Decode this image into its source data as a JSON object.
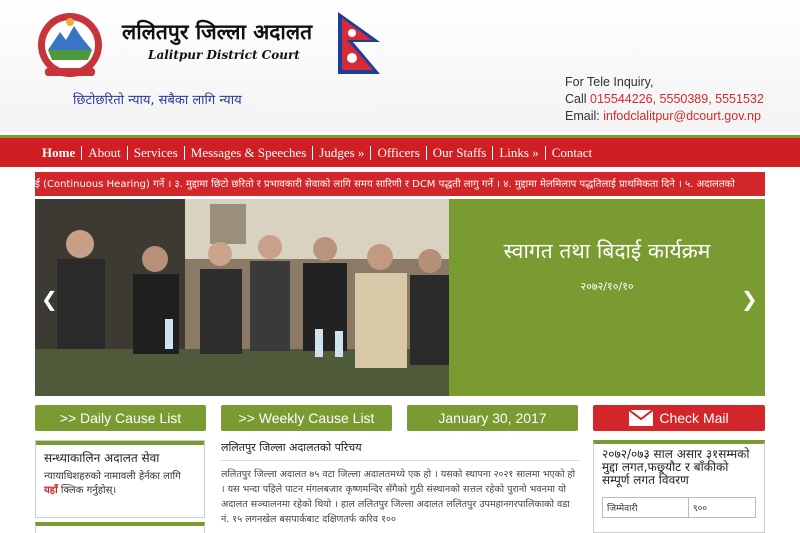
{
  "header": {
    "title_np": "ललितपुर जिल्ला अदालत",
    "title_en": "Lalitpur District Court",
    "tagline": "छिटोछरितो न्याय, सबैका लागि न्याय",
    "contact_heading": "For Tele Inquiry,",
    "call_label": "Call",
    "phones": "015544226, 5550389, 5551532",
    "email_label": "Email:",
    "email": "infodclalitpur@dcourt.gov.np"
  },
  "nav": [
    "Home",
    "About",
    "Services",
    "Messages & Speeches",
    "Judges »",
    "Officers",
    "Our Staffs",
    "Links »",
    "Contact"
  ],
  "ticker": "ई (Continuous Hearing) गर्ने । ३. मुद्दामा छिटो छरितो र प्रभावकारी सेवाको लागि समय सारिणी र DCM पद्धती लागु गर्ने । ४. मुद्दामा मेलमिलाप पद्धतिलाई प्राथमिकता दिने । ५. अदालतको",
  "slide": {
    "title": "स्वागत तथा बिदाई कार्यक्रम",
    "date": "२०७२/१०/१०"
  },
  "buttons": {
    "daily": ">> Daily Cause List",
    "weekly": ">> Weekly Cause List",
    "date": "January 30, 2017",
    "mail": "Check Mail"
  },
  "left_box": {
    "title": "सन्ध्याकालिन अदालत सेवा",
    "text": "न्यायाधिशहरुको नामावली हेर्नका लागि",
    "link": "यहाँ",
    "text_after": "क्लिक गर्नुहोस्।"
  },
  "intro": {
    "title": "ललितपुर जिल्ला अदालतको परिचय",
    "body": "ललितपुर जिल्ला अदालत ७५ वटा जिल्ला अदालतमध्ये एक हो । यसको स्थापना २०२१ सालमा भएको हो । यस भन्दा पहिले पाटन मंगलबजार कृष्णमन्दिर सँगैको गुठी संस्थानको सत्तल रहेको पुरानो भवनमा यो अदालत सञ्चालनमा रहेको थियो । हाल ललितपुर जिल्ला अदालत ललितपुर उपमहानगरपालिकाको वडा नं. १५ लगनखेल बसपार्कबाट दक्षिणतर्फ करिव १००"
  },
  "right_box": {
    "title": "२०७२/०७३ साल असार ३१सम्मको मुद्दा लगत,फछ्र्यौट र बाँकीको सम्पूर्ण लगत विवरण",
    "row_label": "जिम्मेवारी",
    "row_value": "९००"
  },
  "colors": {
    "red": "#d3262a",
    "green": "#7a9a32",
    "nav_red": "#cf1f24"
  }
}
